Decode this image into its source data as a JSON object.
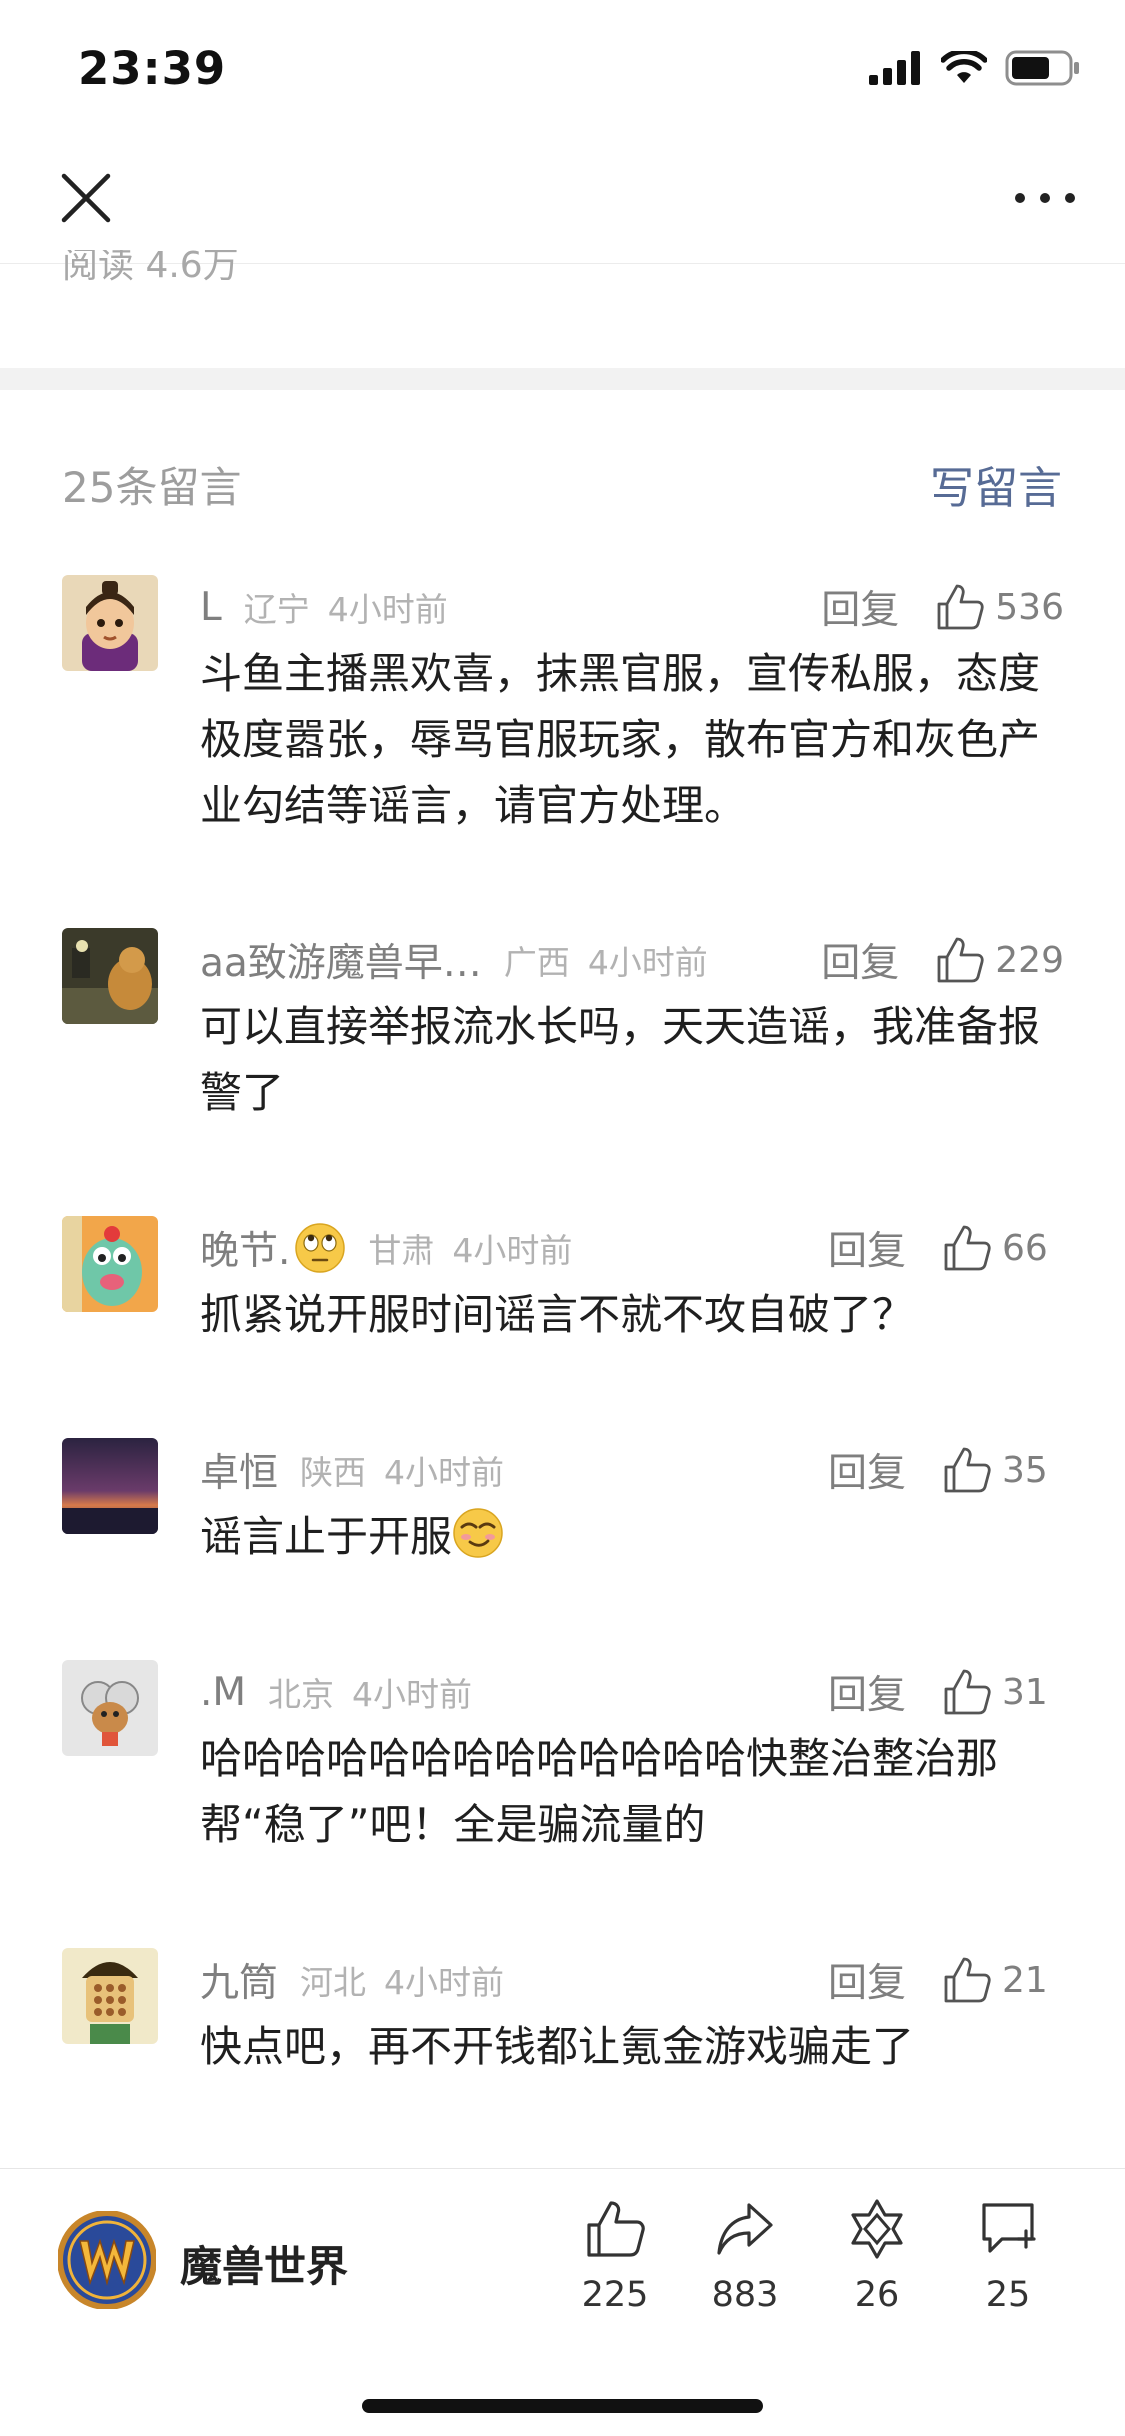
{
  "status_bar": {
    "time": "23:39",
    "icons": [
      "cellular-signal-icon",
      "wifi-icon",
      "battery-icon"
    ]
  },
  "nav": {
    "close_icon": "close-icon",
    "more_icon": "more-icon"
  },
  "article": {
    "read_count": "阅读 4.6万"
  },
  "comments_section": {
    "count_label": "25条留言",
    "write_label": "写留言",
    "accent_color": "#576b95",
    "reply_label": "回复",
    "comments": [
      {
        "name": "L",
        "location": "辽宁",
        "time": "4小时前",
        "likes": "536",
        "text": "斗鱼主播黑欢喜，抹黑官服，宣传私服，态度极度嚣张，辱骂官服玩家，散布官方和灰色产业勾结等谣言，请官方处理。"
      },
      {
        "name": "aa致游魔兽早…",
        "location": "广西",
        "time": "4小时前",
        "likes": "229",
        "text": "可以直接举报流水长吗，天天造谣，我准备报警了"
      },
      {
        "name": "晚节.",
        "name_emoji": "eye-roll-emoji",
        "location": "甘肃",
        "time": "4小时前",
        "likes": "66",
        "text": "抓紧说开服时间谣言不就不攻自破了？"
      },
      {
        "name": "卓恒",
        "location": "陕西",
        "time": "4小时前",
        "likes": "35",
        "text": "谣言止于开服",
        "text_emoji": "smirk-emoji"
      },
      {
        "name": ".M",
        "location": "北京",
        "time": "4小时前",
        "likes": "31",
        "text": "哈哈哈哈哈哈哈哈哈哈哈哈哈快整治整治那帮“稳了”吧！全是骗流量的"
      },
      {
        "name": "九筒",
        "location": "河北",
        "time": "4小时前",
        "likes": "21",
        "text": "快点吧，再不开钱都让氪金游戏骗走了"
      }
    ]
  },
  "bottom_bar": {
    "account_name": "魔兽世界",
    "like_count": "225",
    "share_count": "883",
    "wow_count": "26",
    "comment_count": "25"
  }
}
